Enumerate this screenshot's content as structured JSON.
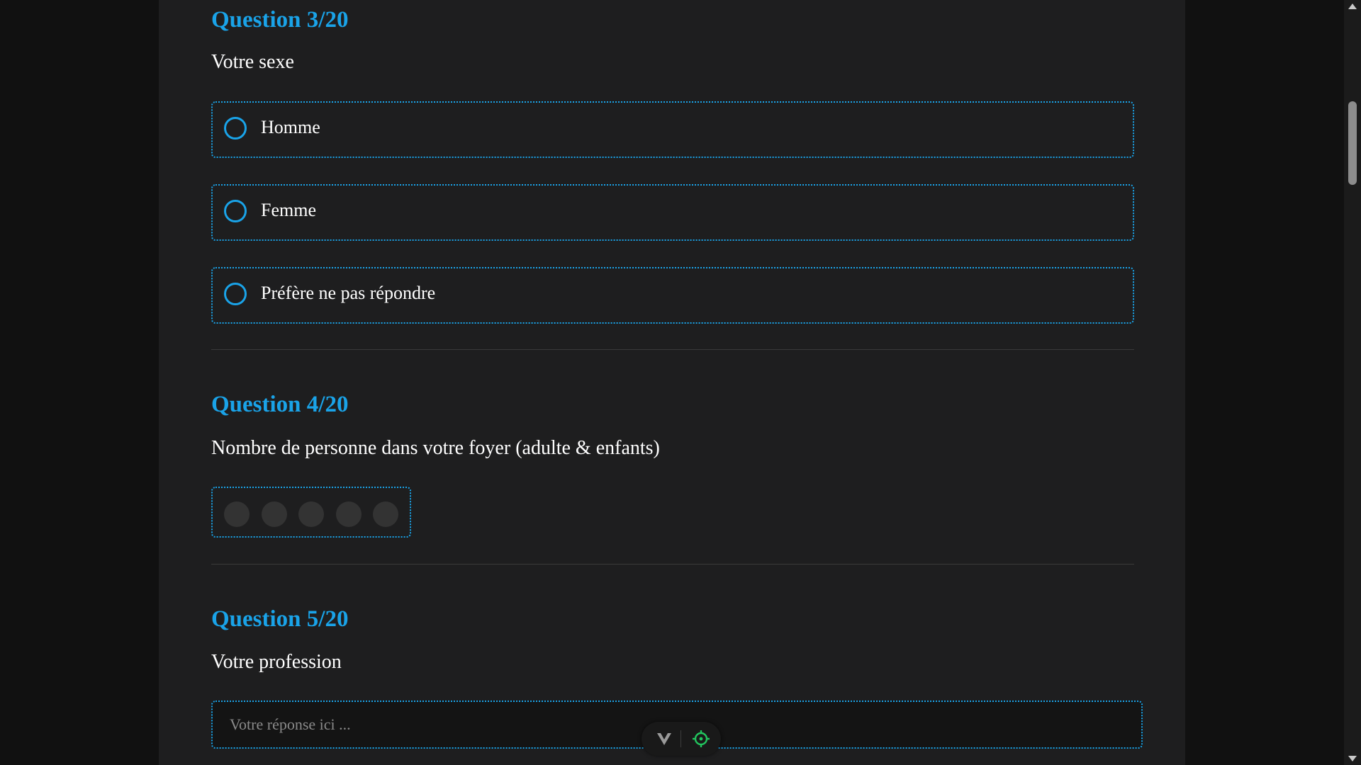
{
  "questions": [
    {
      "title": "Question 3/20",
      "text": "Votre sexe",
      "options": [
        "Homme",
        "Femme",
        "Préfère ne pas répondre"
      ]
    },
    {
      "title": "Question 4/20",
      "text": "Nombre de personne dans votre foyer (adulte & enfants)",
      "rating_count": 5,
      "rating_selected": 0
    },
    {
      "title": "Question 5/20",
      "text": "Votre profession",
      "placeholder": "Votre réponse ici ..."
    }
  ],
  "colors": {
    "accent": "#1aa3e8",
    "background": "#1e1e1f",
    "outer_background": "#111111",
    "text": "#ffffff",
    "dot_inactive": "#333333",
    "extension_icon": "#22c55e"
  },
  "icons": {
    "floating_left": "v-logo-icon",
    "floating_right": "crosshair-target-icon"
  }
}
